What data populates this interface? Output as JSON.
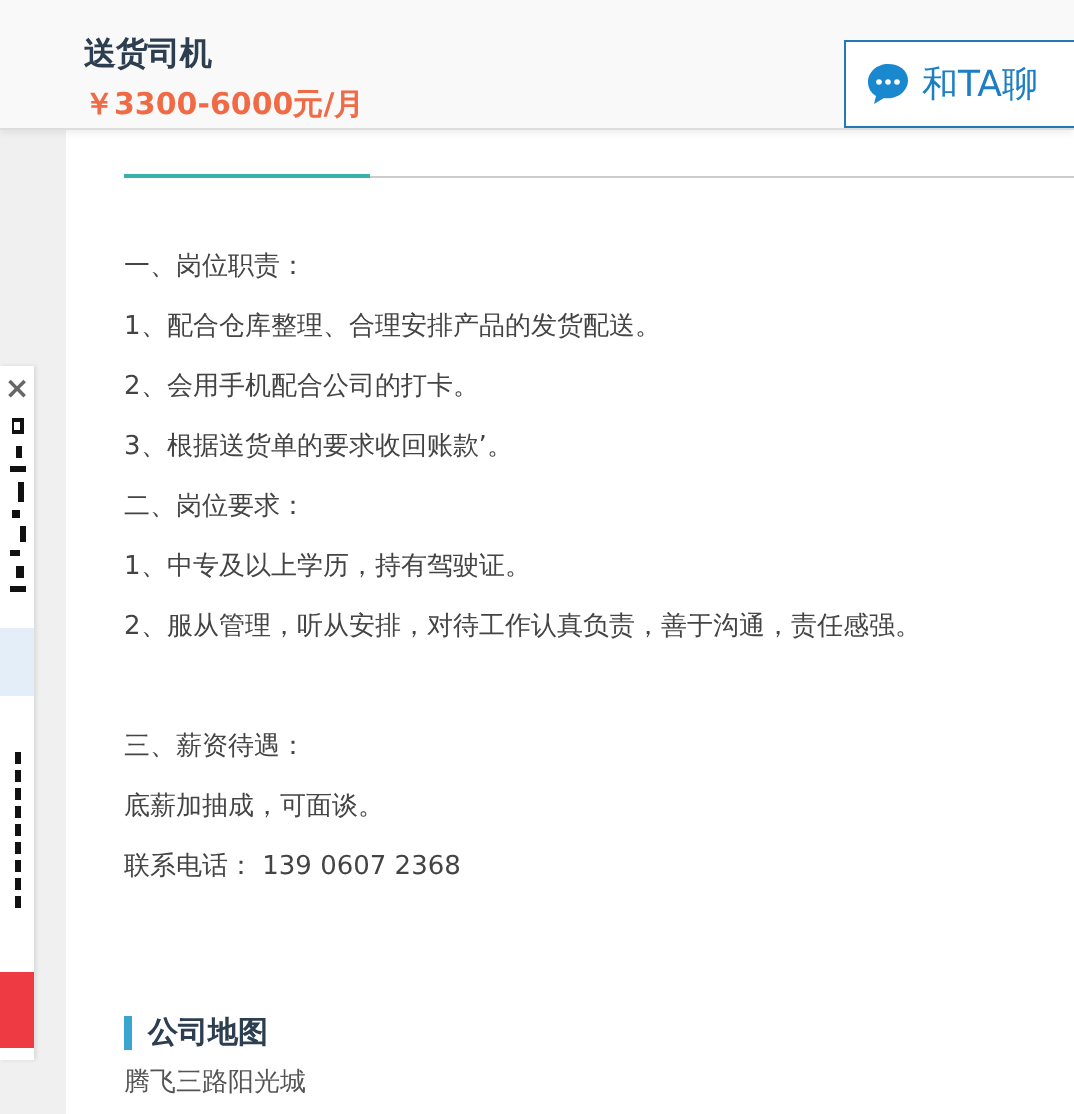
{
  "header": {
    "title": "送货司机",
    "salary": "￥3300-6000元/月",
    "chat_button": "和TA聊"
  },
  "side_panel": {
    "close": "×"
  },
  "description_blocks": [
    [
      "一、岗位职责：",
      "1、配合仓库整理、合理安排产品的发货配送。",
      "2、会用手机配合公司的打卡。",
      "3、根据送货单的要求收回账款’。",
      "二、岗位要求：",
      "1、中专及以上学历，持有驾驶证。",
      "2、服从管理，听从安排，对待工作认真负责，善于沟通，责任感强。"
    ],
    [
      "三、薪资待遇：",
      "底薪加抽成，可面谈。",
      "联系电话： 139 0607 2368"
    ]
  ],
  "map_section": {
    "title": "公司地图",
    "address": "腾飞三路阳光城"
  }
}
